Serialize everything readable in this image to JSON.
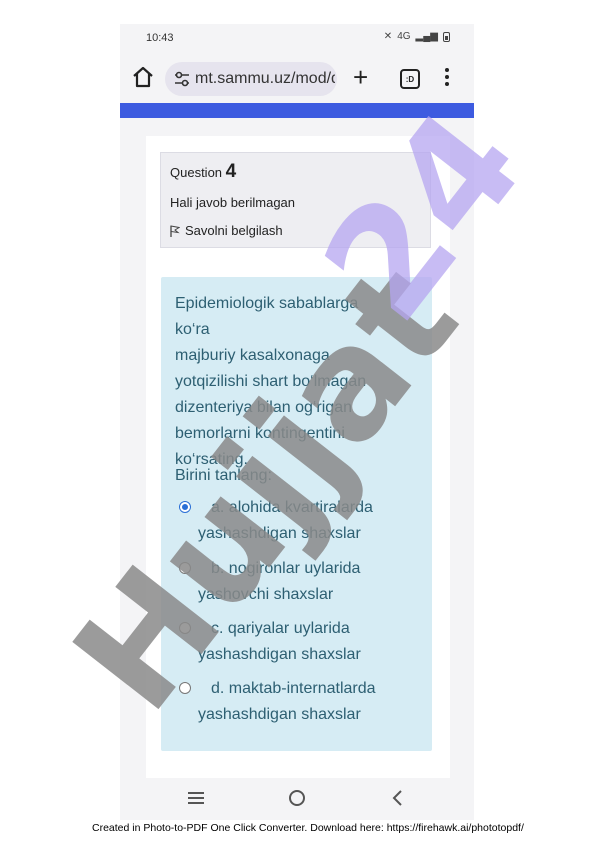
{
  "status_bar": {
    "time": "10:43",
    "network": "4G"
  },
  "browser": {
    "url": "mt.sammu.uz/mod/q",
    "tabs_count": ":D"
  },
  "question": {
    "label": "Question",
    "number": "4",
    "state": "Hali javob berilmagan",
    "flag_label": "Savolni belgilash",
    "text_lines": [
      "Epidemiologik sabablarga ko‘ra",
      "majburiy kasalxonaga",
      "yotqizilishi shart bo‘lmagan",
      "dizenteriya bilan og‘rigan",
      "bemorlarni kontingentini",
      "ko‘rsating."
    ],
    "choose_label": "Birini tanlang:",
    "options": [
      {
        "line1": "a. alohida kvartiralarda",
        "line2": "yashashdigan shaxslar",
        "selected": true
      },
      {
        "line1": "b. nogironlar uylarida",
        "line2": "yashovchi shaxslar",
        "selected": false
      },
      {
        "line1": "c. qariyalar uylarida",
        "line2": "yashashdigan shaxslar",
        "selected": false
      },
      {
        "line1": "d. maktab-internatlarda",
        "line2": "yashashdigan shaxslar",
        "selected": false
      }
    ]
  },
  "watermark": {
    "text_big": "Hujjat",
    "text_num": "24",
    "gray": "#8a8a8a",
    "purple": "#b5a6f0"
  },
  "footer": {
    "credit": "Created in Photo-to-PDF One Click Converter. Download here: https://firehawk.ai/phototopdf/"
  },
  "colors": {
    "accent": "#3d5be0",
    "question_bg": "#d6ecf4",
    "question_text": "#2d5f72"
  }
}
